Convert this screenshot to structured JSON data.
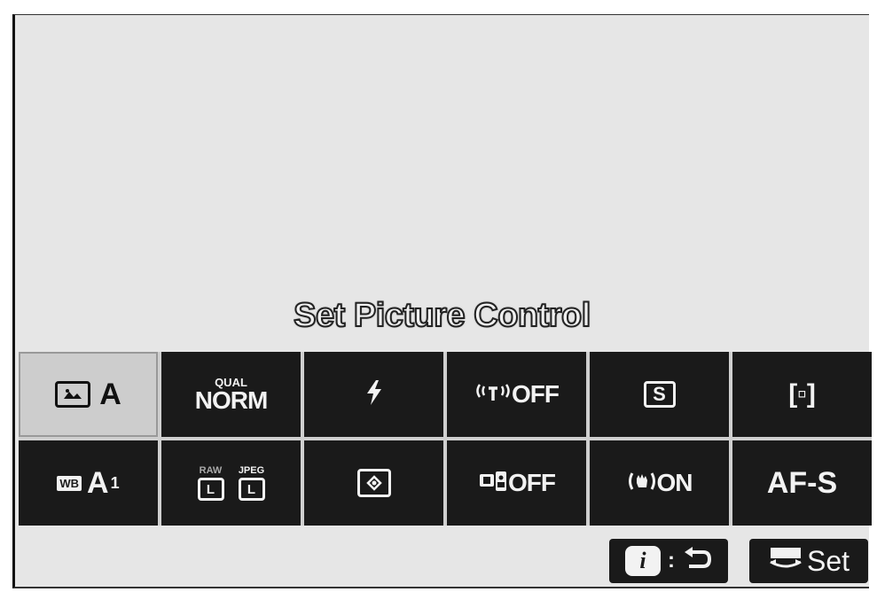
{
  "menu": {
    "current_item_label": "Set Picture Control"
  },
  "grid": {
    "row1": [
      {
        "id": "picture-control",
        "value": "A"
      },
      {
        "id": "image-quality",
        "caption": "QUAL",
        "value": "NORM"
      },
      {
        "id": "flash-mode",
        "icon": "flash-icon"
      },
      {
        "id": "wireless",
        "icon": "wireless-icon",
        "value": "OFF"
      },
      {
        "id": "active-dlighting",
        "icon": "s-icon",
        "icon_text": "S"
      },
      {
        "id": "af-area-mode",
        "icon": "af-area-icon",
        "value": "[▫]"
      }
    ],
    "row2": [
      {
        "id": "white-balance",
        "badge": "WB",
        "value": "A",
        "sub": "1"
      },
      {
        "id": "image-size",
        "raw_caption": "RAW",
        "jpeg_caption": "JPEG",
        "raw_value": "L",
        "jpeg_value": "L"
      },
      {
        "id": "metering",
        "icon": "matrix-metering-icon"
      },
      {
        "id": "bluetooth-connection",
        "icon": "bluetooth-camera-icon",
        "value": "OFF"
      },
      {
        "id": "vibration-reduction",
        "icon": "vr-icon",
        "value": "ON"
      },
      {
        "id": "focus-mode",
        "value": "AF-S"
      }
    ]
  },
  "footer": {
    "info_key_glyph": "i",
    "info_separator": ":",
    "info_icon": "return-icon",
    "set_icon": "command-dial-icon",
    "set_label": "Set"
  }
}
